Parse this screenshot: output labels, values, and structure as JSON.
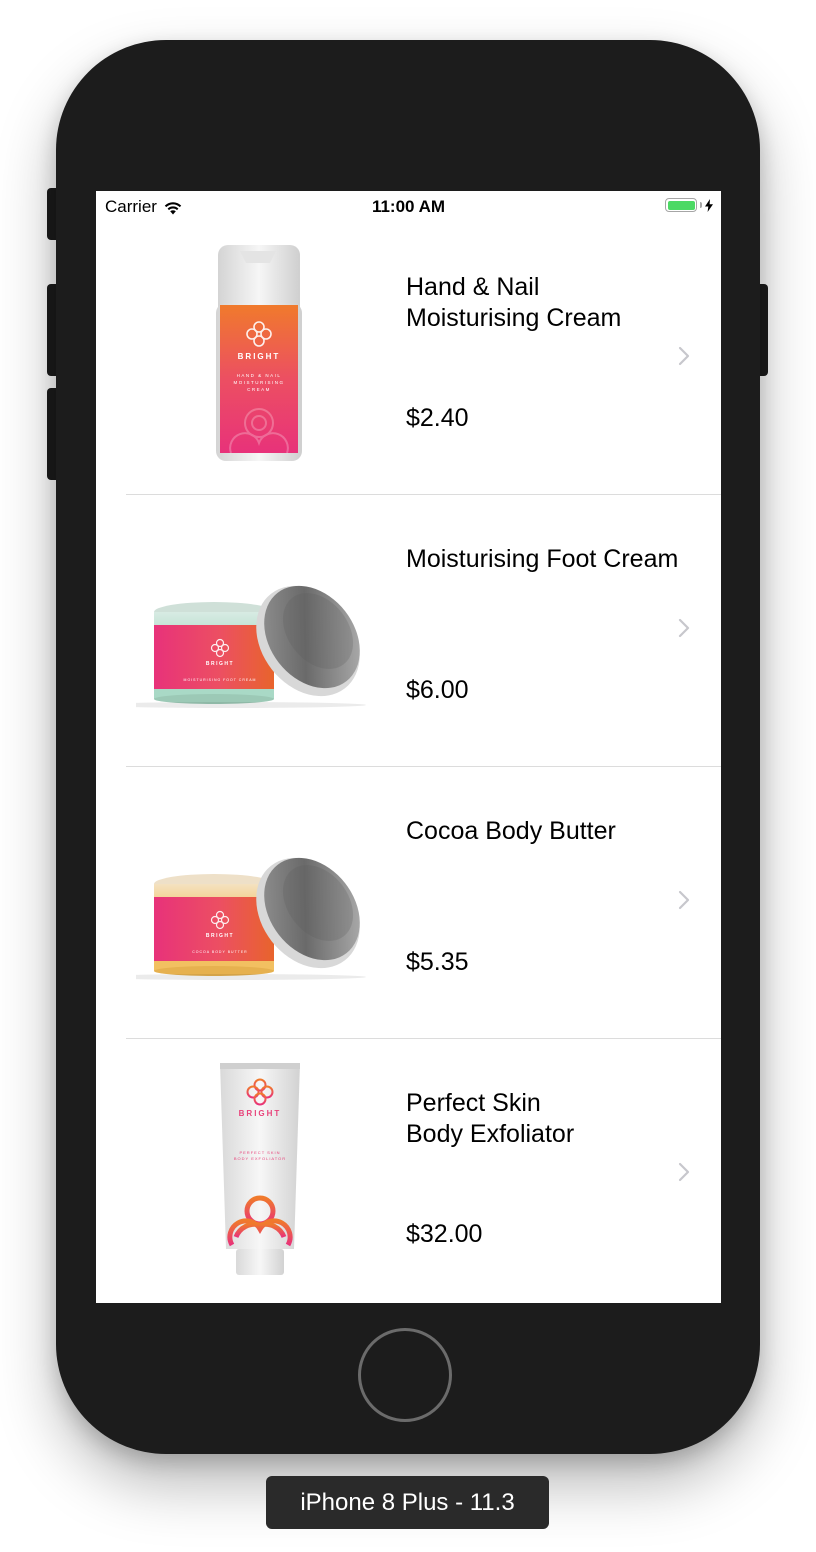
{
  "status_bar": {
    "carrier": "Carrier",
    "time": "11:00 AM",
    "battery_color": "#4cd964"
  },
  "products": [
    {
      "name": "Hand & Nail\nMoisturising Cream",
      "price": "$2.40",
      "image": "bottle",
      "label_brand": "BRIGHT",
      "label_text": "HAND & NAIL MOISTURISING CREAM"
    },
    {
      "name": "Moisturising Foot Cream",
      "price": "$6.00",
      "image": "jar-mint",
      "label_brand": "BRIGHT",
      "label_text": "MOISTURISING FOOT CREAM"
    },
    {
      "name": "Cocoa Body Butter",
      "price": "$5.35",
      "image": "jar-yellow",
      "label_brand": "BRIGHT",
      "label_text": "COCOA BODY BUTTER"
    },
    {
      "name": "Perfect Skin\nBody Exfoliator",
      "price": "$32.00",
      "image": "tube",
      "label_brand": "BRIGHT",
      "label_text": "PERFECT SKIN BODY EXFOLIATOR"
    }
  ],
  "device_label": "iPhone 8 Plus - 11.3",
  "colors": {
    "brand_pink": "#e8327a",
    "brand_orange": "#f07a2c",
    "chevron": "#c7c7cc",
    "separator": "#dcdcdc",
    "phone_body": "#1c1c1c"
  },
  "icons": [
    "wifi-icon",
    "battery-icon",
    "charging-bolt-icon",
    "chevron-right-icon",
    "home-button"
  ]
}
